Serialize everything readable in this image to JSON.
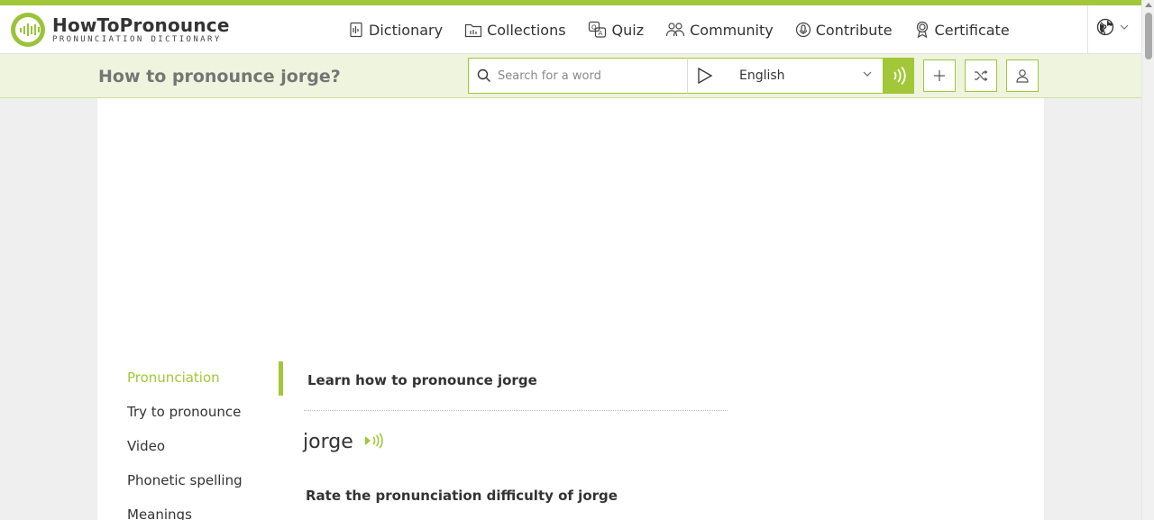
{
  "brand": {
    "name": "HowToPronounce",
    "tagline": "PRONUNCIATION DICTIONARY",
    "accent_color": "#a2c738"
  },
  "nav": {
    "items": [
      {
        "label": "Dictionary",
        "icon": "dictionary-icon"
      },
      {
        "label": "Collections",
        "icon": "collections-icon"
      },
      {
        "label": "Quiz",
        "icon": "quiz-icon"
      },
      {
        "label": "Community",
        "icon": "community-icon"
      },
      {
        "label": "Contribute",
        "icon": "microphone-icon"
      },
      {
        "label": "Certificate",
        "icon": "certificate-icon"
      }
    ],
    "language_switch_icon": "globe-icon"
  },
  "subbar": {
    "heading": "How to pronounce jorge?",
    "search_placeholder": "Search for a word",
    "language": "English",
    "buttons": [
      "add-icon",
      "shuffle-icon",
      "user-icon"
    ]
  },
  "sidebar": {
    "items": [
      {
        "label": "Pronunciation",
        "active": true
      },
      {
        "label": "Try to pronounce",
        "active": false
      },
      {
        "label": "Video",
        "active": false
      },
      {
        "label": "Phonetic spelling",
        "active": false
      },
      {
        "label": "Meanings",
        "active": false
      }
    ]
  },
  "content": {
    "learn_title": "Learn how to pronounce jorge",
    "word": "jorge",
    "rate_text": "Rate the pronunciation difficulty of jorge"
  }
}
